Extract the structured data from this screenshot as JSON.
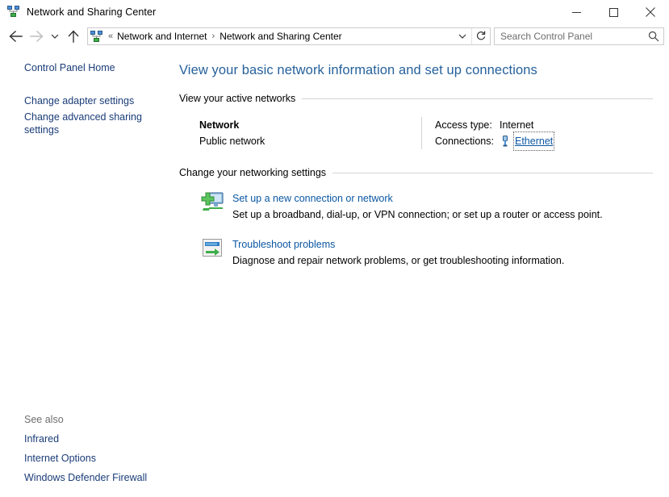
{
  "window": {
    "title": "Network and Sharing Center",
    "icon": "network-icon",
    "controls": {
      "minimize": "minimize-button",
      "maximize": "maximize-button",
      "close": "close-button"
    }
  },
  "navbar": {
    "back": "back-arrow-icon",
    "forward": "forward-arrow-icon",
    "recent": "chevron-down-icon",
    "up": "up-arrow-icon",
    "address_icon": "network-icon",
    "breadcrumb_prefix": "«",
    "breadcrumbs": [
      {
        "label": "Network and Internet"
      },
      {
        "label": "Network and Sharing Center"
      }
    ],
    "breadcrumb_separator": "›",
    "dropdown": "chevron-down-icon",
    "refresh": "refresh-icon"
  },
  "search": {
    "placeholder": "Search Control Panel",
    "value": "",
    "icon": "search-icon"
  },
  "sidebar": {
    "home_link": "Control Panel Home",
    "items": [
      {
        "label": "Change adapter settings"
      },
      {
        "label": "Change advanced sharing settings"
      }
    ],
    "see_also": {
      "title": "See also",
      "items": [
        {
          "label": "Infrared"
        },
        {
          "label": "Internet Options"
        },
        {
          "label": "Windows Defender Firewall"
        }
      ]
    }
  },
  "main": {
    "page_title": "View your basic network information and set up connections",
    "active_networks": {
      "section_title": "View your active networks",
      "network_name": "Network",
      "network_type": "Public network",
      "access_type_label": "Access type:",
      "access_type_value": "Internet",
      "connections_label": "Connections:",
      "connection_name": "Ethernet",
      "connection_icon": "ethernet-icon"
    },
    "networking_settings": {
      "section_title": "Change your networking settings",
      "tasks": [
        {
          "icon": "new-connection-icon",
          "title": "Set up a new connection or network",
          "description": "Set up a broadband, dial-up, or VPN connection; or set up a router or access point."
        },
        {
          "icon": "troubleshoot-icon",
          "title": "Troubleshoot problems",
          "description": "Diagnose and repair network problems, or get troubleshooting information."
        }
      ]
    }
  },
  "colors": {
    "page_title": "#26619c",
    "link": "#0b57a4",
    "sidebar_link": "#1a3c78",
    "rule": "#d4d4d4",
    "muted": "#6d6d6d"
  }
}
